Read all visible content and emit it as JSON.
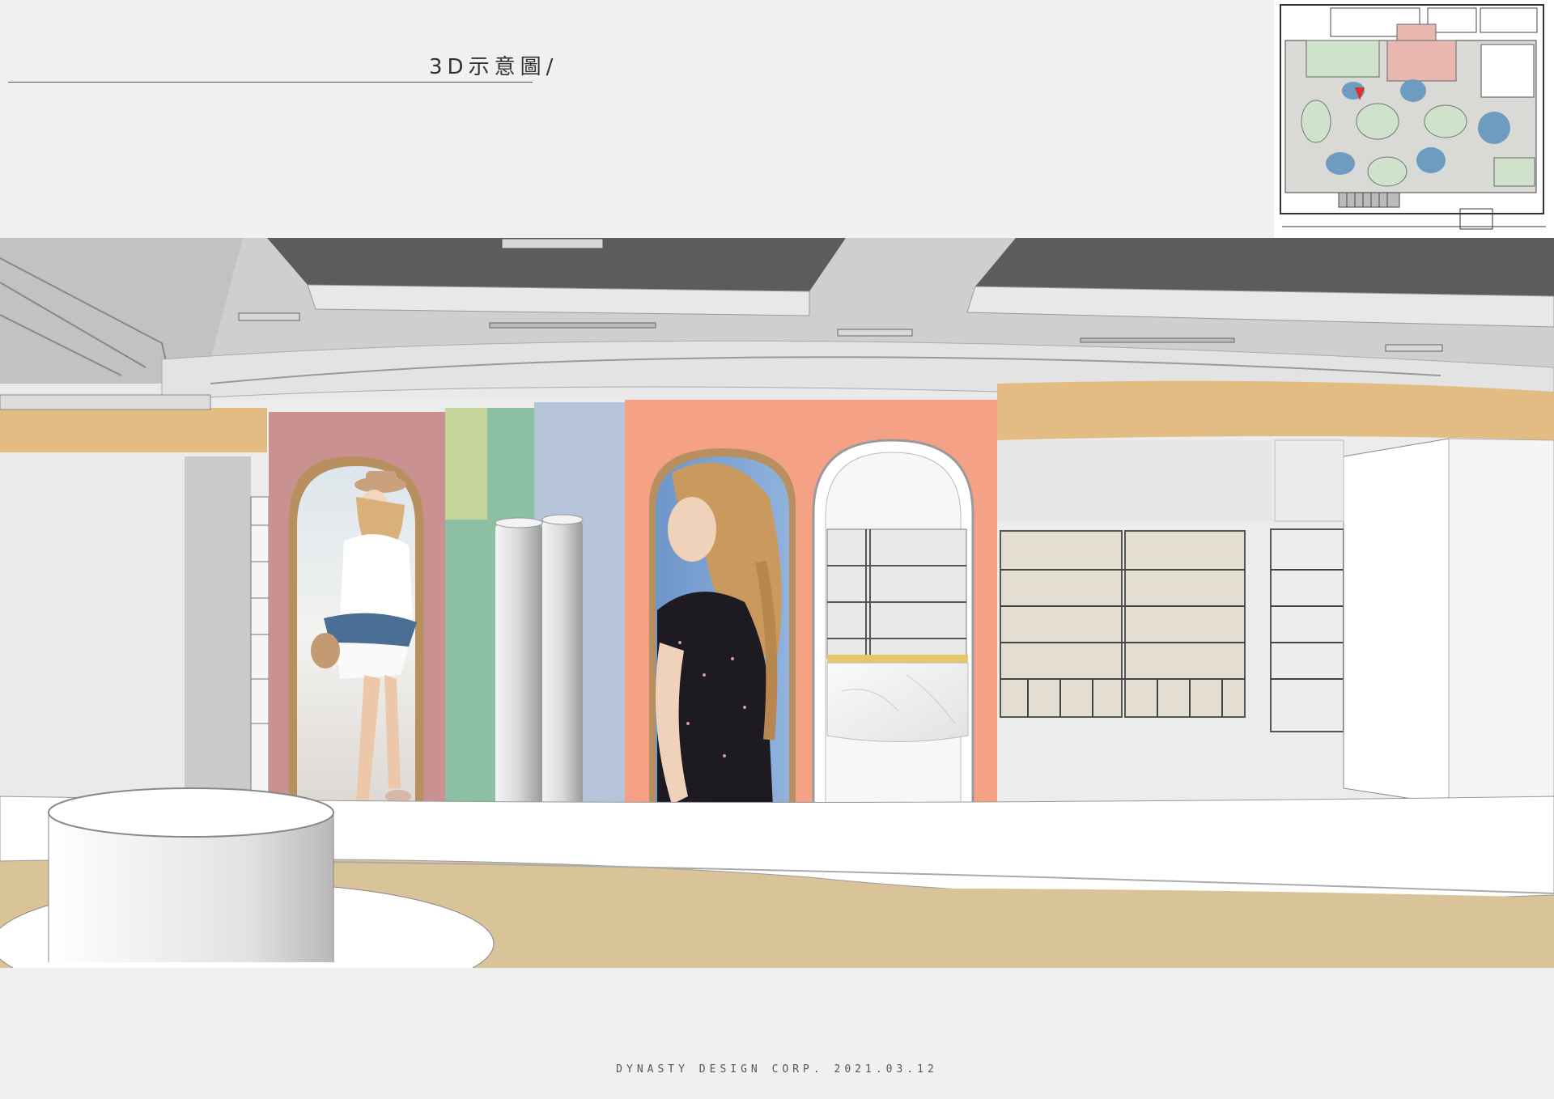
{
  "header": {
    "title": "3D示意圖/"
  },
  "footer": {
    "credit": "DYNASTY DESIGN CORP. 2021.03.12"
  },
  "floorplan": {
    "icon": "floor-plan-thumbnail",
    "view_marker_color": "#e0302a"
  },
  "render": {
    "icon": "interior-3d-rendering",
    "colors": {
      "pink_wall": "#c99190",
      "salmon_wall": "#f4a186",
      "green_light": "#c5d59a",
      "green_mint": "#8dbfa5",
      "blue_gray": "#b5c4d8",
      "wood_band": "#e2bc82",
      "floor_tan": "#d9c398",
      "ceiling_dark": "#5c5c5c"
    }
  }
}
